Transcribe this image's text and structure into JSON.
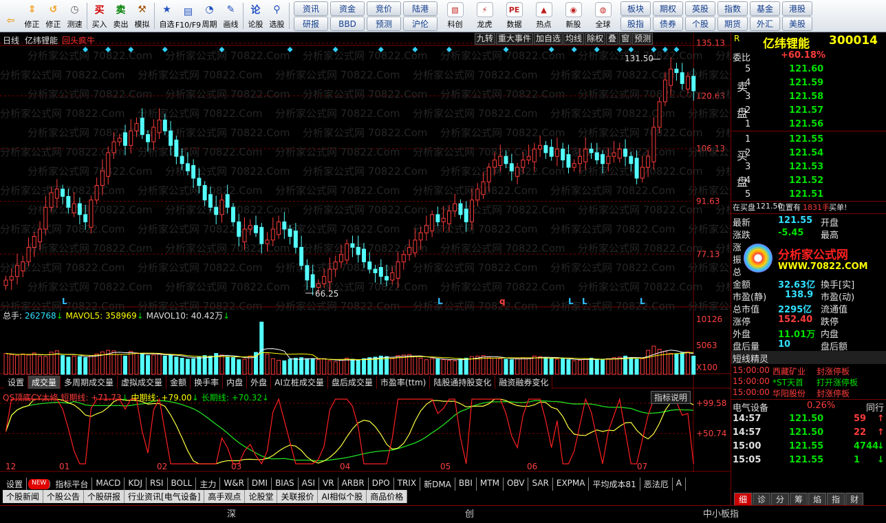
{
  "toolbar": {
    "left_buttons": [
      {
        "name": "back-button",
        "label": "",
        "icon": "back-arrow-icon",
        "color": "#f0a020"
      },
      {
        "name": "page-up-button",
        "label": "修正",
        "icon": "arrow-up-down-icon",
        "color": "#f0a020"
      },
      {
        "name": "restore-button",
        "label": "修正",
        "icon": "restore-icon",
        "color": "#f0a020"
      },
      {
        "name": "test-button",
        "label": "测速",
        "icon": "clock-icon",
        "color": "#606060"
      },
      {
        "name": "buy-button",
        "label": "买入",
        "icon": "buy-icon",
        "color": "#d00000"
      },
      {
        "name": "sell-button",
        "label": "卖出",
        "icon": "sell-icon",
        "color": "#008000"
      },
      {
        "name": "simulate-button",
        "label": "模拟",
        "icon": "hammer-icon",
        "color": "#a05000"
      },
      {
        "name": "favorite-button",
        "label": "自选",
        "icon": "star-icon",
        "color": "#2050c0"
      },
      {
        "name": "f10-button",
        "label": "F10/F9",
        "icon": "document-icon",
        "color": "#2050c0"
      },
      {
        "name": "period-button",
        "label": "周期",
        "icon": "cycle-icon",
        "color": "#2050c0"
      },
      {
        "name": "draw-button",
        "label": "画线",
        "icon": "pencil-icon",
        "color": "#2050c0"
      },
      {
        "name": "forum-button",
        "label": "论股",
        "icon": "discuss-icon",
        "color": "#2050c0"
      },
      {
        "name": "pick-button",
        "label": "选股",
        "icon": "magnifier-chart-icon",
        "color": "#2050c0"
      }
    ],
    "grid1": [
      "资讯",
      "资金",
      "竞价",
      "陆港",
      "研报",
      "BBD",
      "预测",
      "沪伦"
    ],
    "mid_buttons": [
      {
        "name": "tech-button",
        "label": "科创",
        "icon": "chart-icon"
      },
      {
        "name": "dragon-button",
        "label": "龙虎",
        "icon": "dragon-icon"
      },
      {
        "name": "data-button",
        "label": "数据",
        "icon": "pe-icon"
      },
      {
        "name": "hot-button",
        "label": "热点",
        "icon": "hot-icon"
      },
      {
        "name": "ipo-button",
        "label": "新股",
        "icon": "ipo-icon"
      },
      {
        "name": "global-button",
        "label": "全球",
        "icon": "globe-icon"
      }
    ],
    "grid2": [
      "板块",
      "股指",
      "期权",
      "债券",
      "英股",
      "个股",
      "指数",
      "期货",
      "基金",
      "外汇",
      "港股",
      "美股"
    ]
  },
  "chart": {
    "title_period": "日线",
    "title_name": "亿纬锂能",
    "title_tag": "回头疯牛",
    "top_buttons": [
      "九转",
      "重大事件",
      "加自选",
      "均线",
      "除权",
      "叠",
      "窗",
      "预测"
    ],
    "watermark": "分析家公式网 70822.Com",
    "price_axis": [
      "135.13",
      "120.63",
      "106.13",
      "91.63",
      "77.13"
    ],
    "high_label": "131.50",
    "low_label": "66.25",
    "signal_marks": [
      "L",
      "L",
      "q",
      "L",
      "L",
      "L"
    ],
    "volume": {
      "total_label": "总手: ",
      "total_value": "262768",
      "mavol5_label": "MAVOL5: ",
      "mavol5_value": "358969",
      "mavol10_label": "MAVOL10: ",
      "mavol10_value": "40.42万",
      "axis": [
        "10126",
        "5063",
        "X100"
      ]
    },
    "indicator_tabs": [
      "设置",
      "成交量",
      "多周期成交量",
      "虚拟成交量",
      "金额",
      "换手率",
      "内盘",
      "外盘",
      "AI立桩成交量",
      "盘后成交量",
      "市盈率(ttm)",
      "陆股通持股变化",
      "融资融券变化"
    ],
    "indicator_selected": "成交量",
    "qs": {
      "name": "QS顶底CY太修",
      "short_label": "短期线: ",
      "short_value": "+71.73",
      "mid_label": "中期线: ",
      "mid_value": "+79.00",
      "long_label": "长期线: ",
      "long_value": "+70.32",
      "help": "指标说明",
      "axis": [
        "+99.58",
        "+50.74"
      ]
    },
    "months": [
      "12",
      "01",
      "02",
      "03",
      "04",
      "05",
      "06",
      "07"
    ],
    "indicator_bar": [
      "设置",
      "NEW",
      "指标平台",
      "MACD",
      "KDJ",
      "RSI",
      "BOLL",
      "主力",
      "W&R",
      "DMI",
      "BIAS",
      "ASI",
      "VR",
      "ARBR",
      "DPO",
      "TRIX",
      "新DMA",
      "BBI",
      "MTM",
      "OBV",
      "SAR",
      "EXPMA",
      "平均成本81",
      "恶法厄",
      "A"
    ],
    "news_tabs": [
      "个股新闻",
      "个股公告",
      "个股研报",
      "行业资讯[电气设备]",
      "高手观点",
      "论股堂",
      "关联报价",
      "AI相似个股",
      "商品价格"
    ],
    "colors": {
      "up": "#ff3c3c",
      "down": "#54ffff",
      "grid": "#7a0000",
      "ma5": "#ffffff",
      "ma10": "#ffff00",
      "short": "#ff2020",
      "mid": "#ffff40",
      "long": "#20e020"
    }
  },
  "chart_data": {
    "type": "candlestick",
    "title": "亿纬锂能 日线",
    "ylim": [
      63,
      136
    ],
    "high": 131.5,
    "low": 66.25,
    "close": [
      70,
      71,
      74,
      75,
      79,
      82,
      84,
      90,
      94,
      95,
      93,
      90,
      91,
      88,
      86,
      92,
      96,
      100,
      105,
      108,
      109,
      107,
      111,
      113,
      110,
      108,
      112,
      114,
      111,
      107,
      104,
      102,
      100,
      98,
      96,
      92,
      90,
      88,
      92,
      90,
      86,
      82,
      84,
      85,
      83,
      80,
      81,
      84,
      86,
      84,
      82,
      79,
      74,
      70,
      68,
      69,
      71,
      73,
      75,
      77,
      80,
      79,
      77,
      75,
      73,
      72,
      71,
      70,
      72,
      75,
      77,
      79,
      81,
      83,
      85,
      88,
      86,
      87,
      89,
      91,
      88,
      86,
      92,
      95,
      97,
      101,
      103,
      104,
      102,
      100,
      101,
      103,
      104,
      106,
      107,
      105,
      104,
      106,
      103,
      101,
      102,
      104,
      106,
      105,
      103,
      102,
      104,
      105,
      106,
      104,
      102,
      98,
      101,
      104,
      112,
      119,
      125,
      128,
      127,
      124,
      126,
      122
    ],
    "volume": [
      80,
      76,
      72,
      78,
      74,
      82,
      70,
      68,
      85,
      90,
      72,
      66,
      70,
      68,
      64,
      72,
      78,
      86,
      92,
      90,
      76,
      70,
      88,
      82,
      78,
      72,
      74,
      80,
      70,
      76,
      66,
      62,
      58,
      60,
      66,
      72,
      70,
      80,
      74,
      68,
      64,
      56,
      58,
      70,
      84,
      200,
      78,
      60,
      54,
      52,
      58,
      62,
      64,
      60,
      58,
      56,
      60,
      52,
      48,
      54,
      62,
      58,
      54,
      60,
      64,
      66,
      70,
      68,
      60,
      72,
      74,
      76,
      68,
      62,
      56,
      60,
      58,
      56,
      54,
      52,
      60,
      62,
      68,
      70,
      72,
      66,
      62,
      60,
      58,
      56,
      60,
      64,
      62,
      70,
      68,
      64,
      60,
      58,
      62,
      56,
      52,
      54,
      60,
      62,
      58,
      56,
      60,
      64,
      66,
      70,
      62,
      58,
      60,
      92,
      108,
      96,
      88,
      80,
      78,
      82,
      86,
      70
    ]
  },
  "right_panel": {
    "name": "亿纬锂能",
    "code": "300014",
    "r_mark": "R",
    "webi_label": "委比",
    "webi_value": "+60.18%",
    "sell_label": "卖盘",
    "buy_label": "买盘",
    "sell": [
      [
        "5",
        "121.60"
      ],
      [
        "4",
        "121.59"
      ],
      [
        "3",
        "121.58"
      ],
      [
        "2",
        "121.57"
      ],
      [
        "1",
        "121.56"
      ]
    ],
    "buy": [
      [
        "1",
        "121.55"
      ],
      [
        "2",
        "121.54"
      ],
      [
        "3",
        "121.53"
      ],
      [
        "4",
        "121.52"
      ],
      [
        "5",
        "121.51"
      ]
    ],
    "notice_pre": "在买盘",
    "notice_price": "121.50",
    "notice_mid": "位置有",
    "notice_vol": "1831手",
    "notice_post": "买单!",
    "quote": [
      [
        "最新",
        "121.55",
        "开盘",
        ""
      ],
      [
        "涨跌",
        "-5.45",
        "最高",
        ""
      ],
      [
        "涨",
        "",
        "",
        ""
      ],
      [
        "振",
        "",
        "",
        ""
      ],
      [
        "总",
        "",
        "",
        ""
      ],
      [
        "金额",
        "32.63亿",
        "換手[实]",
        ""
      ],
      [
        "市盈(静)",
        "138.9",
        "市盈(动)",
        ""
      ],
      [
        "总市值",
        "2295亿",
        "流通值",
        ""
      ],
      [
        "涨停",
        "152.40",
        "跌停",
        ""
      ],
      [
        "外盘",
        "11.01万",
        "内盘",
        ""
      ],
      [
        "盘后量",
        "10",
        "盘后额",
        ""
      ]
    ],
    "logo_text": "分析家公式网",
    "logo_url": "WWW.70822.COM",
    "elf_title": "短线精灵",
    "elf": [
      [
        "15:00:00",
        "西藏矿业",
        "封涨停板"
      ],
      [
        "15:00:00",
        "*ST天首",
        "打开涨停板"
      ],
      [
        "15:00:00",
        "华阳股份",
        "封涨停板"
      ]
    ],
    "sector": "电气设备",
    "sector_pct": "0.26%",
    "sector_more": "同行",
    "ticks": [
      [
        "14:57",
        "121.50",
        "59",
        "up"
      ],
      [
        "14:57",
        "121.50",
        "22",
        "up"
      ],
      [
        "15:00",
        "121.55",
        "4744",
        "down"
      ],
      [
        "15:05",
        "121.55",
        "1",
        "down"
      ]
    ],
    "bottom_tabs": [
      "细",
      "诊",
      "分",
      "筹",
      "焰",
      "指",
      "财"
    ]
  },
  "status": {
    "a": "深",
    "b": "创",
    "c": "中小板指"
  }
}
